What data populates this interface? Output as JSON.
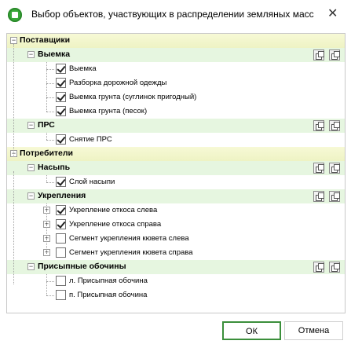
{
  "window": {
    "title": "Выбор объектов, участвующих в распределении земляных масс",
    "close_icon": "close-icon"
  },
  "tree": [
    {
      "label": "Поставщики",
      "level": 0,
      "style": "yellow"
    },
    {
      "label": "Выемка",
      "level": 1,
      "style": "green"
    },
    {
      "label": "Выемка",
      "level": 2,
      "checked": true
    },
    {
      "label": "Разборка дорожной одежды",
      "level": 2,
      "checked": true
    },
    {
      "label": "Выемка грунта (суглинок пригодный)",
      "level": 2,
      "checked": true
    },
    {
      "label": "Выемка грунта (песок)",
      "level": 2,
      "checked": true
    },
    {
      "label": "ПРС",
      "level": 1,
      "style": "green"
    },
    {
      "label": "Снятие ПРС",
      "level": 2,
      "checked": true
    },
    {
      "label": "Потребители",
      "level": 0,
      "style": "yellow"
    },
    {
      "label": "Насыпь",
      "level": 1,
      "style": "green"
    },
    {
      "label": "Слой насыпи",
      "level": 2,
      "checked": true
    },
    {
      "label": "Укрепления",
      "level": 1,
      "style": "green"
    },
    {
      "label": "Укрепление откоса слева",
      "level": 2,
      "checked": true,
      "expandable": true
    },
    {
      "label": "Укрепление откоса справа",
      "level": 2,
      "checked": true,
      "expandable": true
    },
    {
      "label": "Сегмент укрепления кювета слева",
      "level": 2,
      "checked": false,
      "expandable": true
    },
    {
      "label": "Сегмент укрепления кювета справа",
      "level": 2,
      "checked": false,
      "expandable": true
    },
    {
      "label": "Присыпные обочины",
      "level": 1,
      "style": "green"
    },
    {
      "label": "л. Присыпная обочина",
      "level": 2,
      "checked": false
    },
    {
      "label": "п. Присыпная обочина",
      "level": 2,
      "checked": false
    }
  ],
  "buttons": {
    "ok": "ОК",
    "cancel": "Отмена"
  },
  "colors": {
    "accent": "#3b8f3b",
    "group_green": "#e6f6e0",
    "group_yellow": "#f3f6cc"
  }
}
